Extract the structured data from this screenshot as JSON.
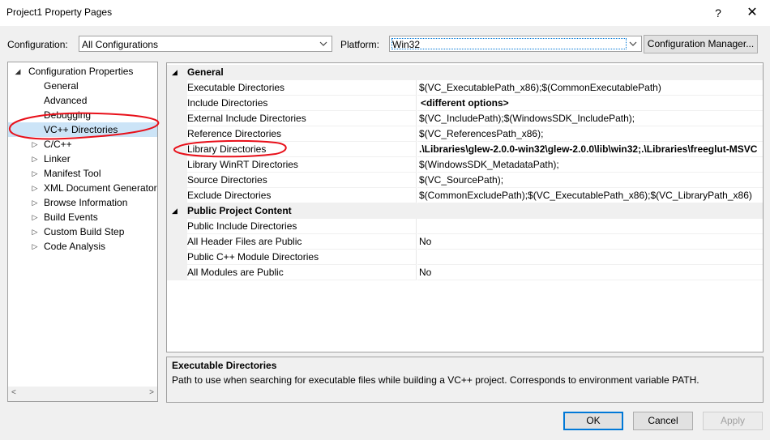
{
  "window": {
    "title": "Project1 Property Pages",
    "help_glyph": "?",
    "close_glyph": "✕"
  },
  "config_bar": {
    "configuration_label": "Configuration:",
    "configuration_value": "All Configurations",
    "platform_label": "Platform:",
    "platform_value": "Win32",
    "config_manager_label": "Configuration Manager..."
  },
  "tree": {
    "root": "Configuration Properties",
    "items": [
      {
        "label": "General"
      },
      {
        "label": "Advanced"
      },
      {
        "label": "Debugging"
      },
      {
        "label": "VC++ Directories"
      },
      {
        "label": "C/C++"
      },
      {
        "label": "Linker"
      },
      {
        "label": "Manifest Tool"
      },
      {
        "label": "XML Document Generator"
      },
      {
        "label": "Browse Information"
      },
      {
        "label": "Build Events"
      },
      {
        "label": "Custom Build Step"
      },
      {
        "label": "Code Analysis"
      }
    ]
  },
  "grid": {
    "sections": [
      {
        "title": "General",
        "rows": [
          {
            "name": "Executable Directories",
            "value": "$(VC_ExecutablePath_x86);$(CommonExecutablePath)"
          },
          {
            "name": "Include Directories",
            "value": "<different options>"
          },
          {
            "name": "External Include Directories",
            "value": "$(VC_IncludePath);$(WindowsSDK_IncludePath);"
          },
          {
            "name": "Reference Directories",
            "value": "$(VC_ReferencesPath_x86);"
          },
          {
            "name": "Library Directories",
            "value": ".\\Libraries\\glew-2.0.0-win32\\glew-2.0.0\\lib\\win32;.\\Libraries\\freeglut-MSVC"
          },
          {
            "name": "Library WinRT Directories",
            "value": "$(WindowsSDK_MetadataPath);"
          },
          {
            "name": "Source Directories",
            "value": "$(VC_SourcePath);"
          },
          {
            "name": "Exclude Directories",
            "value": "$(CommonExcludePath);$(VC_ExecutablePath_x86);$(VC_LibraryPath_x86)"
          }
        ]
      },
      {
        "title": "Public Project Content",
        "rows": [
          {
            "name": "Public Include Directories",
            "value": ""
          },
          {
            "name": "All Header Files are Public",
            "value": "No"
          },
          {
            "name": "Public C++ Module Directories",
            "value": ""
          },
          {
            "name": "All Modules are Public",
            "value": "No"
          }
        ]
      }
    ]
  },
  "description": {
    "title": "Executable Directories",
    "text": "Path to use when searching for executable files while building a VC++ project.  Corresponds to environment variable PATH."
  },
  "buttons": {
    "ok": "OK",
    "cancel": "Cancel",
    "apply": "Apply"
  },
  "colors": {
    "annotation": "#e8101a",
    "selection": "#cce4f7",
    "accent": "#0078d7"
  }
}
